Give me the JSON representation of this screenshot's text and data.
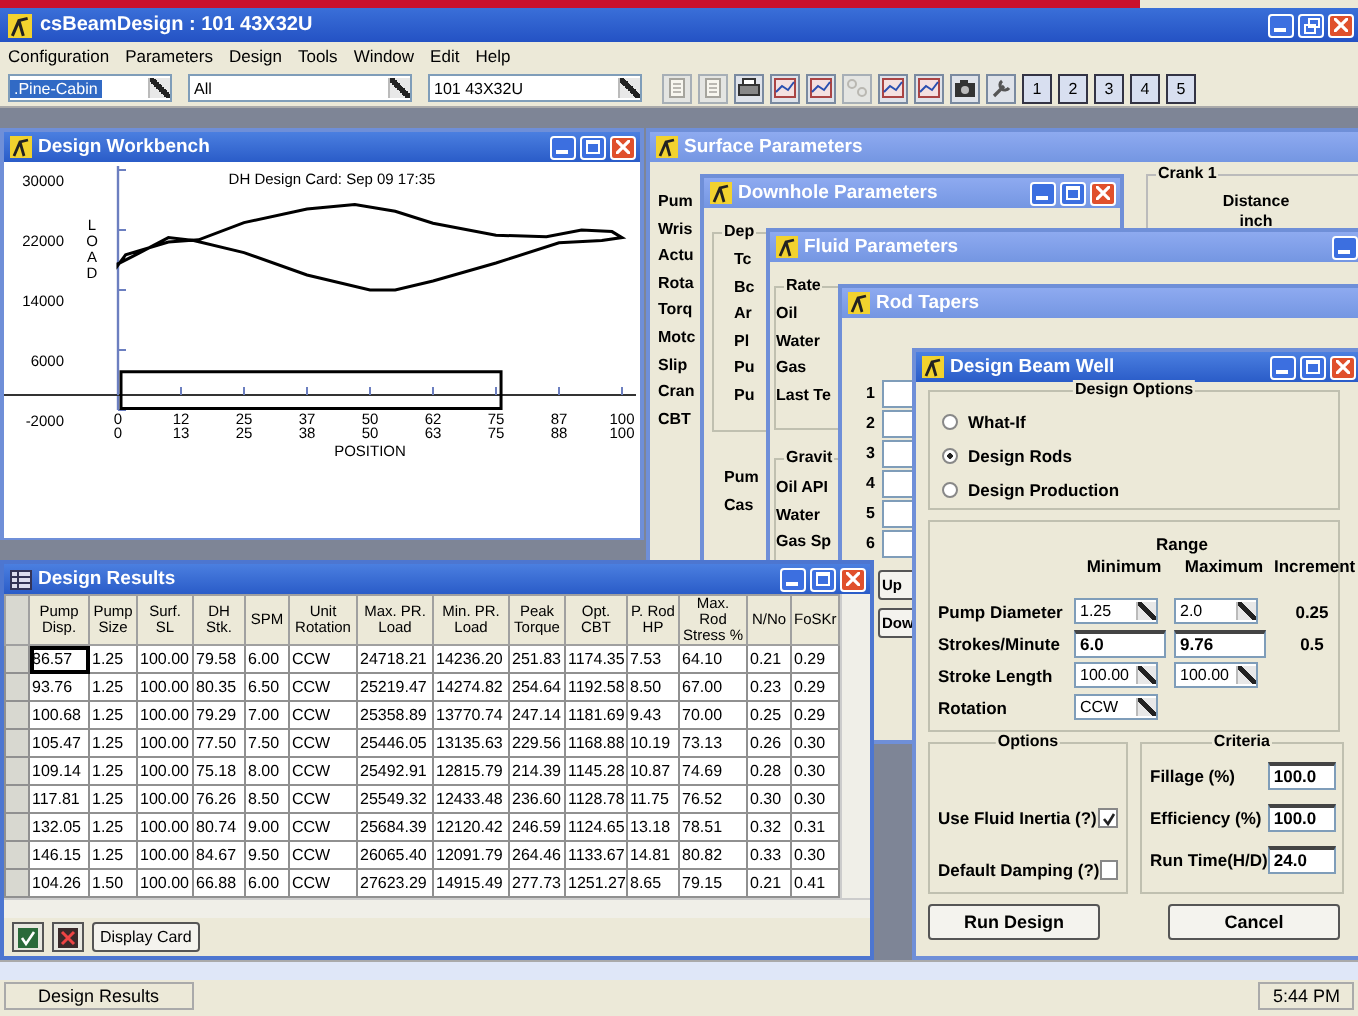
{
  "app": {
    "title": "csBeamDesign : 101 43X32U"
  },
  "menu": [
    "Configuration",
    "Parameters",
    "Design",
    "Tools",
    "Window",
    "Edit",
    "Help"
  ],
  "toolbar": {
    "combos": [
      {
        "value": ".Pine-Cabin",
        "highlighted": true
      },
      {
        "value": "All",
        "highlighted": false
      },
      {
        "value": "101 43X32U",
        "highlighted": false
      }
    ],
    "number_buttons": [
      "1",
      "2",
      "3",
      "4",
      "5"
    ]
  },
  "workbench": {
    "title": "Design Workbench",
    "chart": {
      "title": "DH Design Card: Sep 09 17:35",
      "xlabel": "POSITION",
      "ylabel": "LOAD",
      "xticks": [
        [
          "0",
          "0"
        ],
        [
          "12",
          "13"
        ],
        [
          "25",
          "25"
        ],
        [
          "37",
          "38"
        ],
        [
          "50",
          "50"
        ],
        [
          "62",
          "63"
        ],
        [
          "75",
          "75"
        ],
        [
          "87",
          "88"
        ],
        [
          "100",
          "100"
        ]
      ],
      "yticks": [
        "30000",
        "22000",
        "14000",
        "6000",
        "-2000"
      ]
    }
  },
  "surface": {
    "title": "Surface Parameters",
    "labels": [
      "Pum",
      "Wris",
      "Actu",
      "Rota",
      "Torq",
      "Motc",
      "Slip",
      "Cran",
      "CBT"
    ],
    "crank_group": "Crank 1",
    "distance_header": [
      "Distance",
      "inch"
    ]
  },
  "downhole": {
    "title": "Downhole Parameters",
    "group": "Dep",
    "group_labels": [
      "Tc",
      "Bc",
      "Ar",
      "Pl",
      "Pu",
      "Pu"
    ],
    "labels": [
      "Pum",
      "Cas"
    ]
  },
  "fluid": {
    "title": "Fluid Parameters",
    "rate_group": "Rate",
    "rate_labels": [
      "Oil",
      "Water",
      "Gas",
      "Last Te"
    ],
    "gravity_group": "Gravit",
    "gravity_labels": [
      "Oil API",
      "Water",
      "Gas Sp"
    ]
  },
  "rod_tapers": {
    "title": "Rod Tapers",
    "rows": [
      "1",
      "2",
      "3",
      "4",
      "5",
      "6"
    ],
    "buttons": [
      "Up",
      "Dow"
    ]
  },
  "results": {
    "title": "Design Results",
    "columns": [
      "Pump\nDisp.",
      "Pump\nSize",
      "Surf.\nSL",
      "DH\nStk.",
      "SPM",
      "Unit\nRotation",
      "Max. PR.\nLoad",
      "Min. PR.\nLoad",
      "Peak\nTorque",
      "Opt.\nCBT",
      "P. Rod\nHP",
      "Max. Rod\nStress %",
      "N/No",
      "FoSKr"
    ],
    "rows": [
      {
        "focused": true,
        "cells": [
          "86.57",
          "1.25",
          "100.00",
          "79.58",
          "6.00",
          "CCW",
          "24718.21",
          "14236.20",
          "251.83",
          "1174.35",
          "7.53",
          "64.10",
          "0.21",
          "0.29"
        ]
      },
      {
        "focused": false,
        "cells": [
          "93.76",
          "1.25",
          "100.00",
          "80.35",
          "6.50",
          "CCW",
          "25219.47",
          "14274.82",
          "254.64",
          "1192.58",
          "8.50",
          "67.00",
          "0.23",
          "0.29"
        ]
      },
      {
        "focused": false,
        "cells": [
          "100.68",
          "1.25",
          "100.00",
          "79.29",
          "7.00",
          "CCW",
          "25358.89",
          "13770.74",
          "247.14",
          "1181.69",
          "9.43",
          "70.00",
          "0.25",
          "0.29"
        ]
      },
      {
        "focused": false,
        "cells": [
          "105.47",
          "1.25",
          "100.00",
          "77.50",
          "7.50",
          "CCW",
          "25446.05",
          "13135.63",
          "229.56",
          "1168.88",
          "10.19",
          "73.13",
          "0.26",
          "0.30"
        ]
      },
      {
        "focused": false,
        "cells": [
          "109.14",
          "1.25",
          "100.00",
          "75.18",
          "8.00",
          "CCW",
          "25492.91",
          "12815.79",
          "214.39",
          "1145.28",
          "10.87",
          "74.69",
          "0.28",
          "0.30"
        ]
      },
      {
        "focused": false,
        "cells": [
          "117.81",
          "1.25",
          "100.00",
          "76.26",
          "8.50",
          "CCW",
          "25549.32",
          "12433.48",
          "236.60",
          "1128.78",
          "11.75",
          "76.52",
          "0.30",
          "0.30"
        ]
      },
      {
        "focused": false,
        "cells": [
          "132.05",
          "1.25",
          "100.00",
          "80.74",
          "9.00",
          "CCW",
          "25684.39",
          "12120.42",
          "246.59",
          "1124.65",
          "13.18",
          "78.51",
          "0.32",
          "0.31"
        ]
      },
      {
        "focused": false,
        "cells": [
          "146.15",
          "1.25",
          "100.00",
          "84.67",
          "9.50",
          "CCW",
          "26065.40",
          "12091.79",
          "264.46",
          "1133.67",
          "14.81",
          "80.82",
          "0.33",
          "0.30"
        ]
      },
      {
        "focused": false,
        "cells": [
          "104.26",
          "1.50",
          "100.00",
          "66.88",
          "6.00",
          "CCW",
          "27623.29",
          "14915.49",
          "277.73",
          "1251.27",
          "8.65",
          "79.15",
          "0.21",
          "0.41"
        ]
      }
    ],
    "display_button": "Display Card"
  },
  "beam_well": {
    "title": "Design Beam Well",
    "options_group": "Design Options",
    "modes": [
      {
        "label": "What-If",
        "selected": false
      },
      {
        "label": "Design Rods",
        "selected": true
      },
      {
        "label": "Design Production",
        "selected": false
      }
    ],
    "range_title": "Range",
    "range_headers": [
      "Minimum",
      "Maximum",
      "Increment"
    ],
    "range_rows": [
      {
        "label": "Pump Diameter",
        "kind": "dropdowns",
        "min": "1.25",
        "max": "2.0",
        "increment": "0.25"
      },
      {
        "label": "Strokes/Minute",
        "kind": "inputs",
        "min": "6.0",
        "max": "9.76",
        "increment": "0.5"
      },
      {
        "label": "Stroke Length",
        "kind": "dropdowns",
        "min": "100.00",
        "max": "100.00"
      },
      {
        "label": "Rotation",
        "kind": "dropdown",
        "min": "CCW"
      }
    ],
    "options_title": "Options",
    "options": [
      {
        "label": "Use Fluid Inertia (?)",
        "checked": true
      },
      {
        "label": "Default Damping (?)",
        "checked": false
      }
    ],
    "criteria_title": "Criteria",
    "criteria": [
      {
        "label": "Fillage (%)",
        "value": "100.0"
      },
      {
        "label": "Efficiency (%)",
        "value": "100.0"
      },
      {
        "label": "Run Time(H/D)",
        "value": "24.0"
      }
    ],
    "buttons": [
      "Run Design",
      "Cancel"
    ]
  },
  "status_bar": {
    "panes": [
      "Design Results"
    ],
    "time": "5:44 PM"
  }
}
